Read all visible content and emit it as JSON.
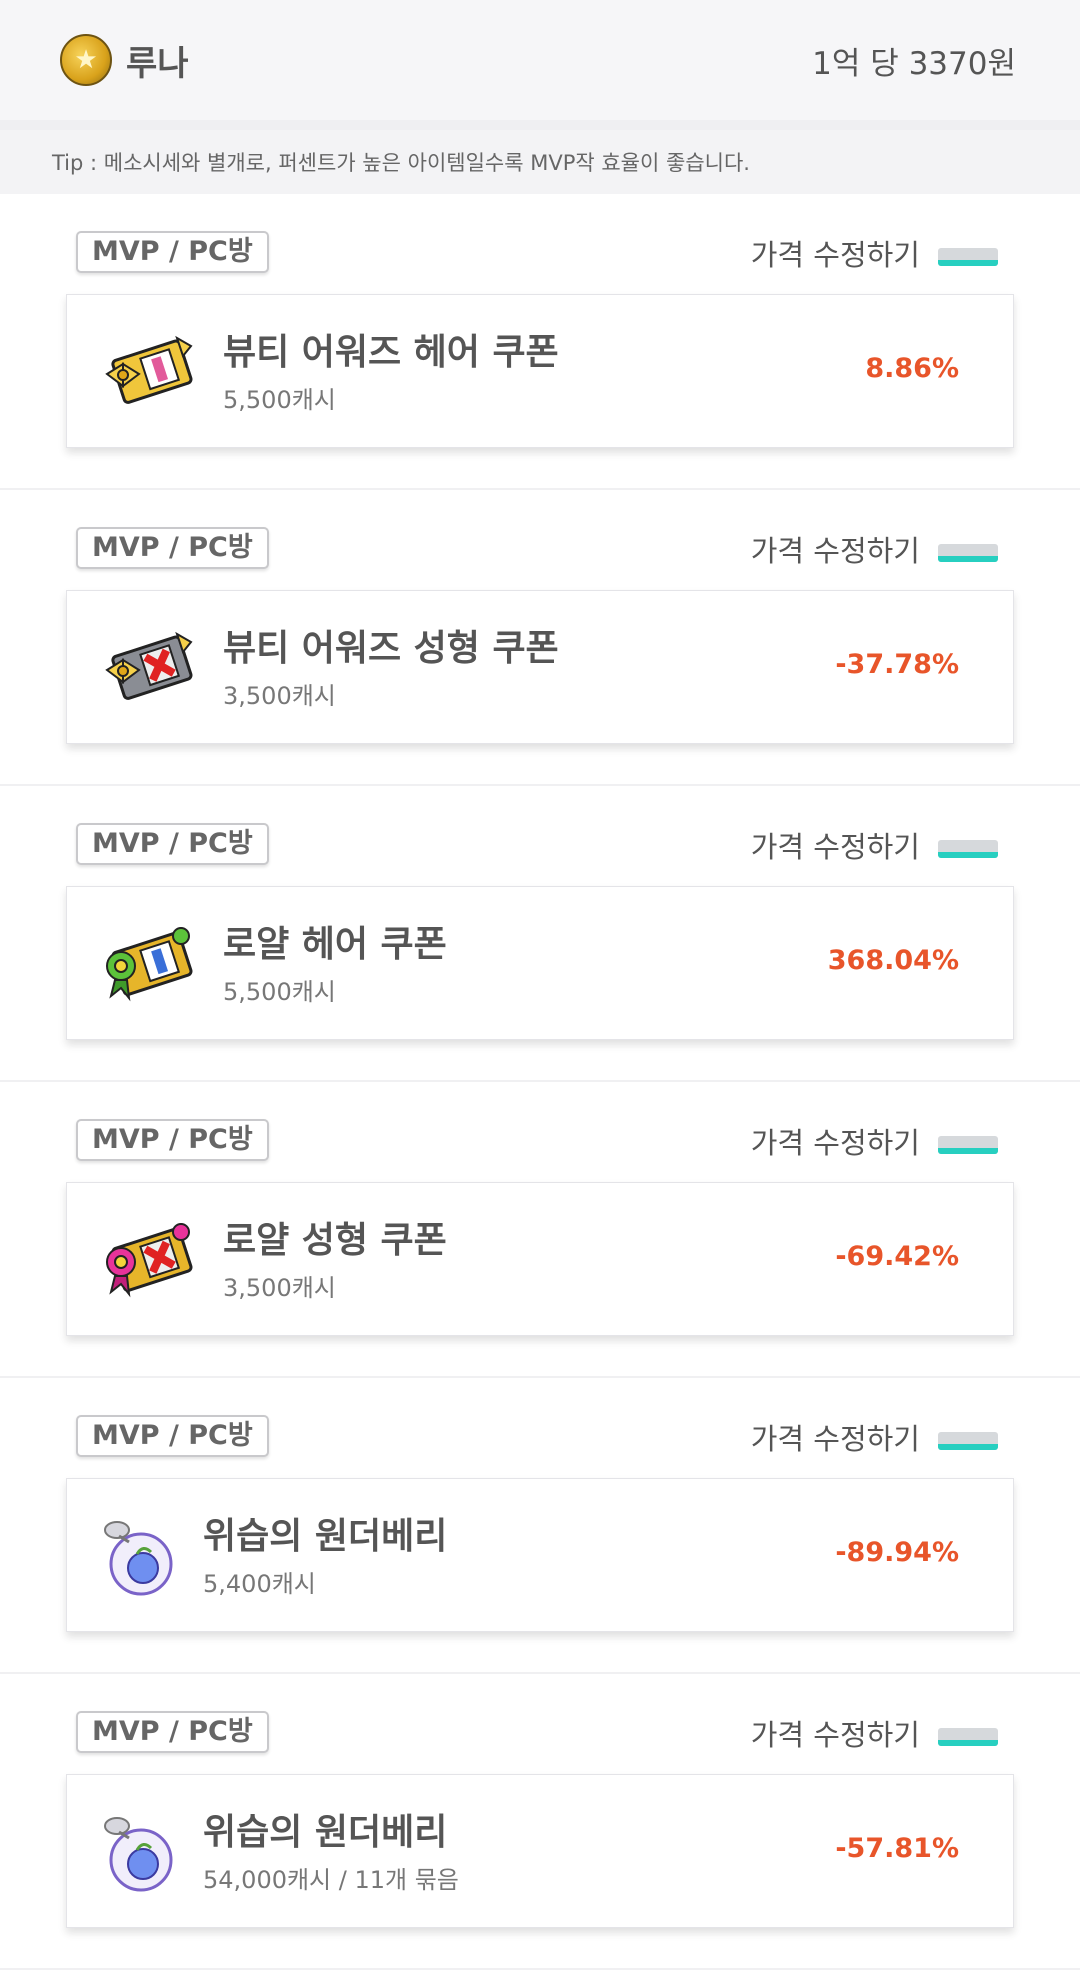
{
  "header": {
    "server_name": "루나",
    "server_icon": "coin-star-icon",
    "rate": "1억 당 3370원"
  },
  "tip": "Tip : 메소시세와 별개로, 퍼센트가 높은 아이템일수록 MVP작 효율이 좋습니다.",
  "colors": {
    "accent": "#27cfc0",
    "percent": "#e8552a"
  },
  "items": [
    {
      "badge": "MVP / PC방",
      "edit_label": "가격 수정하기",
      "name": "뷰티 어워즈 헤어 쿠폰",
      "price": "5,500캐시",
      "percent": "8.86%",
      "icon": "hair-coupon-gold-icon"
    },
    {
      "badge": "MVP / PC방",
      "edit_label": "가격 수정하기",
      "name": "뷰티 어워즈 성형 쿠폰",
      "price": "3,500캐시",
      "percent": "-37.78%",
      "icon": "face-coupon-gold-icon"
    },
    {
      "badge": "MVP / PC방",
      "edit_label": "가격 수정하기",
      "name": "로얄 헤어 쿠폰",
      "price": "5,500캐시",
      "percent": "368.04%",
      "icon": "royal-hair-coupon-icon"
    },
    {
      "badge": "MVP / PC방",
      "edit_label": "가격 수정하기",
      "name": "로얄 성형 쿠폰",
      "price": "3,500캐시",
      "percent": "-69.42%",
      "icon": "royal-face-coupon-icon"
    },
    {
      "badge": "MVP / PC방",
      "edit_label": "가격 수정하기",
      "name": "위습의 원더베리",
      "price": "5,400캐시",
      "percent": "-89.94%",
      "icon": "wonderberry-icon"
    },
    {
      "badge": "MVP / PC방",
      "edit_label": "가격 수정하기",
      "name": "위습의 원더베리",
      "price": "54,000캐시 / 11개 묶음",
      "percent": "-57.81%",
      "icon": "wonderberry-bundle-icon"
    }
  ]
}
